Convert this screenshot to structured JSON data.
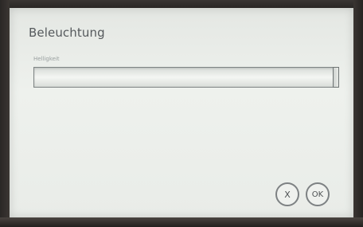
{
  "dialog": {
    "title": "Beleuchtung",
    "field_label": "Helligkeit",
    "brightness_fraction": 0.99
  },
  "buttons": {
    "cancel_label": "X",
    "ok_label": "OK"
  }
}
